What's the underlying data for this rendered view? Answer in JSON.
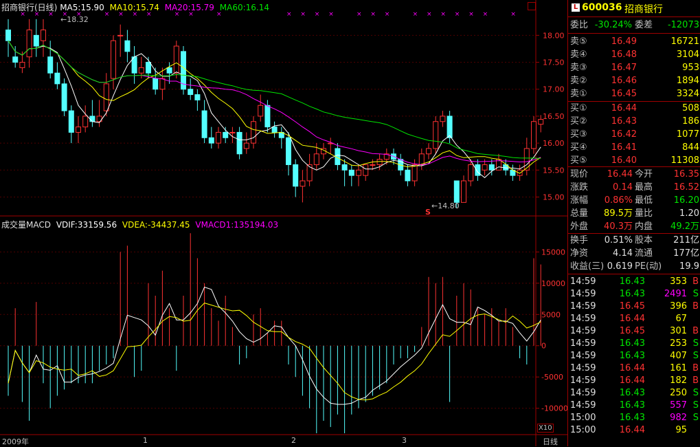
{
  "header": {
    "title": "招商银行(日线)",
    "ma5": "MA5:15.90",
    "ma10": "MA10:15.74",
    "ma20": "MA20:15.79",
    "ma60": "MA60:16.14",
    "colors": {
      "ma5": "#ffffff",
      "ma10": "#ffff00",
      "ma20": "#ff00ff",
      "ma60": "#00e600"
    }
  },
  "price_axis": {
    "ticks": [
      "18.00",
      "17.50",
      "17.00",
      "16.50",
      "16.00",
      "15.50",
      "15.00"
    ]
  },
  "annotations": {
    "high_label": "18.32",
    "low_label": "14.80",
    "signal_s": "S"
  },
  "volume_panel": {
    "title": "成交量MACD",
    "vdif": "VDIF:33159.56",
    "vdea": "VDEA:-34437.45",
    "vmacd": "VMACD1:135194.03",
    "ticks": [
      "15000",
      "10000",
      "5000",
      "0",
      "-5000",
      "-10000"
    ],
    "unit": "X10"
  },
  "date_axis": {
    "labels": [
      "2009年",
      "1",
      "2",
      "3"
    ],
    "period_button": "日线"
  },
  "chart_data": {
    "type": "candlestick",
    "ylim": [
      14.7,
      18.4
    ],
    "candles": [
      [
        18.1,
        17.9,
        18.3,
        17.6
      ],
      [
        17.6,
        17.5,
        17.8,
        17.4
      ],
      [
        17.4,
        17.5,
        17.7,
        17.3
      ],
      [
        17.6,
        18.1,
        18.3,
        17.4
      ],
      [
        18.0,
        17.8,
        18.3,
        17.6
      ],
      [
        17.9,
        18.1,
        18.3,
        17.6
      ],
      [
        17.6,
        17.3,
        17.9,
        17.2
      ],
      [
        17.3,
        17.1,
        17.5,
        17.0
      ],
      [
        17.1,
        16.6,
        17.2,
        16.5
      ],
      [
        16.6,
        16.2,
        16.7,
        16.0
      ],
      [
        16.2,
        16.3,
        16.5,
        16.0
      ],
      [
        16.3,
        16.5,
        16.7,
        16.2
      ],
      [
        16.5,
        16.4,
        16.8,
        16.3
      ],
      [
        16.4,
        16.5,
        16.8,
        16.3
      ],
      [
        16.6,
        17.1,
        17.3,
        16.5
      ],
      [
        17.2,
        17.9,
        18.0,
        17.0
      ],
      [
        18.0,
        18.0,
        18.2,
        17.6
      ],
      [
        17.9,
        17.7,
        18.1,
        17.5
      ],
      [
        17.6,
        17.3,
        17.8,
        17.1
      ],
      [
        17.3,
        17.4,
        17.6,
        17.2
      ],
      [
        17.5,
        17.3,
        17.6,
        17.2
      ],
      [
        17.2,
        17.0,
        17.4,
        16.9
      ],
      [
        17.0,
        17.2,
        17.4,
        16.8
      ],
      [
        17.4,
        17.3,
        17.5,
        17.1
      ],
      [
        17.3,
        17.8,
        17.9,
        17.2
      ],
      [
        17.7,
        17.0,
        17.8,
        16.9
      ],
      [
        17.0,
        16.9,
        17.2,
        16.8
      ],
      [
        16.9,
        16.8,
        17.0,
        16.6
      ],
      [
        16.6,
        16.1,
        16.8,
        16.0
      ],
      [
        16.1,
        16.0,
        16.3,
        15.9
      ],
      [
        16.0,
        16.2,
        16.3,
        15.9
      ],
      [
        16.2,
        16.1,
        16.3,
        16.0
      ],
      [
        16.2,
        16.2,
        16.3,
        16.0
      ],
      [
        16.2,
        15.8,
        16.3,
        15.7
      ],
      [
        15.9,
        16.0,
        16.2,
        15.8
      ],
      [
        16.0,
        16.4,
        16.5,
        15.9
      ],
      [
        16.5,
        16.7,
        16.9,
        16.4
      ],
      [
        16.7,
        16.3,
        16.8,
        16.2
      ],
      [
        16.3,
        16.2,
        16.4,
        16.1
      ],
      [
        16.2,
        16.1,
        16.3,
        15.9
      ],
      [
        16.1,
        15.6,
        16.2,
        15.4
      ],
      [
        15.6,
        15.2,
        15.7,
        15.0
      ],
      [
        15.2,
        15.3,
        15.5,
        14.9
      ],
      [
        15.3,
        15.6,
        15.8,
        15.2
      ],
      [
        15.6,
        15.8,
        16.0,
        15.5
      ],
      [
        15.8,
        15.9,
        16.0,
        15.7
      ],
      [
        16.0,
        16.0,
        16.1,
        15.8
      ],
      [
        15.9,
        15.6,
        16.0,
        15.5
      ],
      [
        15.6,
        15.5,
        15.7,
        15.2
      ],
      [
        15.5,
        15.4,
        15.6,
        15.2
      ],
      [
        15.4,
        15.5,
        15.6,
        15.2
      ],
      [
        15.4,
        15.6,
        15.6,
        15.3
      ],
      [
        15.6,
        15.6,
        15.7,
        15.5
      ],
      [
        15.6,
        15.7,
        15.8,
        15.5
      ],
      [
        15.7,
        15.8,
        15.9,
        15.6
      ],
      [
        15.8,
        15.7,
        15.9,
        15.6
      ],
      [
        15.7,
        15.5,
        15.8,
        15.4
      ],
      [
        15.5,
        15.3,
        15.6,
        15.2
      ],
      [
        15.3,
        15.6,
        15.7,
        15.2
      ],
      [
        15.6,
        15.8,
        15.9,
        15.5
      ],
      [
        15.8,
        15.9,
        16.0,
        15.7
      ],
      [
        15.9,
        16.4,
        16.5,
        15.8
      ],
      [
        16.4,
        16.5,
        16.6,
        16.3
      ],
      [
        16.5,
        16.1,
        16.6,
        16.0
      ],
      [
        15.3,
        14.9,
        15.3,
        14.8
      ],
      [
        14.9,
        15.3,
        15.4,
        14.9
      ],
      [
        15.3,
        15.6,
        15.7,
        15.2
      ],
      [
        15.6,
        15.4,
        15.7,
        15.3
      ],
      [
        15.5,
        15.6,
        15.7,
        15.4
      ],
      [
        15.6,
        15.5,
        15.7,
        15.4
      ],
      [
        15.5,
        15.7,
        15.8,
        15.5
      ],
      [
        15.6,
        15.5,
        15.7,
        15.4
      ],
      [
        15.5,
        15.4,
        15.6,
        15.3
      ],
      [
        15.4,
        15.5,
        15.6,
        15.3
      ],
      [
        15.5,
        15.9,
        16.1,
        15.4
      ],
      [
        15.9,
        16.4,
        16.5,
        15.8
      ],
      [
        16.35,
        16.44,
        16.52,
        16.2
      ]
    ],
    "volume_bars": [
      -8,
      6,
      -9,
      -12,
      7,
      -6,
      -10,
      -8,
      -7,
      -6,
      -6,
      -6,
      -6,
      -4,
      -3,
      -2,
      15,
      16,
      -5,
      -4,
      10,
      8,
      12,
      6,
      -4,
      8,
      18,
      14,
      10,
      6,
      4,
      8,
      3,
      -3,
      -2,
      5,
      6,
      2,
      4,
      4,
      -3,
      -5,
      -8,
      -10,
      -14,
      -12,
      -13,
      -11,
      -14,
      -11,
      -10,
      -9,
      -8,
      -7,
      -6,
      -3,
      -2,
      -2,
      -1,
      3,
      11,
      10,
      11,
      -9,
      8,
      10,
      9,
      6,
      5,
      6,
      4,
      6,
      3,
      -2,
      -3,
      14,
      13
    ],
    "ma_lines": [
      "ma5",
      "ma10",
      "ma20",
      "ma60"
    ]
  },
  "quote": {
    "code": "600036",
    "name": "招商银行",
    "badge": "L",
    "weibi_label": "委比",
    "weibi_value": "-30.24%",
    "weicha_label": "委差",
    "weicha_value": "-12073",
    "sell": [
      {
        "label": "卖⑤",
        "price": "16.49",
        "vol": "16721"
      },
      {
        "label": "卖④",
        "price": "16.48",
        "vol": "3104"
      },
      {
        "label": "卖③",
        "price": "16.47",
        "vol": "953"
      },
      {
        "label": "卖②",
        "price": "16.46",
        "vol": "1894"
      },
      {
        "label": "卖①",
        "price": "16.45",
        "vol": "3324"
      }
    ],
    "buy": [
      {
        "label": "买①",
        "price": "16.44",
        "vol": "508"
      },
      {
        "label": "买②",
        "price": "16.43",
        "vol": "186"
      },
      {
        "label": "买③",
        "price": "16.42",
        "vol": "1077"
      },
      {
        "label": "买④",
        "price": "16.41",
        "vol": "844"
      },
      {
        "label": "买⑤",
        "price": "16.40",
        "vol": "11308"
      }
    ],
    "stats": [
      {
        "l1": "现价",
        "v1": "16.44",
        "c1": "red",
        "l2": "今开",
        "v2": "16.35",
        "c2": "red"
      },
      {
        "l1": "涨跌",
        "v1": "0.14",
        "c1": "red",
        "l2": "最高",
        "v2": "16.52",
        "c2": "red"
      },
      {
        "l1": "涨幅",
        "v1": "0.86%",
        "c1": "red",
        "l2": "最低",
        "v2": "16.20",
        "c2": "green"
      },
      {
        "l1": "总量",
        "v1": "89.5万",
        "c1": "yellow",
        "l2": "量比",
        "v2": "1.20",
        "c2": "white"
      },
      {
        "l1": "外盘",
        "v1": "40.3万",
        "c1": "red",
        "l2": "内盘",
        "v2": "49.2万",
        "c2": "green"
      }
    ],
    "fin": [
      {
        "l1": "换手",
        "v1": "0.51%",
        "l2": "股本",
        "v2": "211亿"
      },
      {
        "l1": "净资",
        "v1": "4.14",
        "l2": "流通",
        "v2": "177亿"
      },
      {
        "l1": "收益(三)",
        "v1": "0.619",
        "l2": "PE(动)",
        "v2": "19.9"
      }
    ],
    "ticks": [
      {
        "time": "14:59",
        "price": "16.43",
        "pc": "green",
        "vol": "353",
        "vc": "yellow",
        "side": "B"
      },
      {
        "time": "14:59",
        "price": "16.43",
        "pc": "green",
        "vol": "2491",
        "vc": "magenta",
        "side": "S"
      },
      {
        "time": "14:59",
        "price": "16.45",
        "pc": "red",
        "vol": "396",
        "vc": "yellow",
        "side": "B"
      },
      {
        "time": "14:59",
        "price": "16.44",
        "pc": "red",
        "vol": "67",
        "vc": "yellow",
        "side": ""
      },
      {
        "time": "14:59",
        "price": "16.45",
        "pc": "red",
        "vol": "301",
        "vc": "yellow",
        "side": "B"
      },
      {
        "time": "14:59",
        "price": "16.43",
        "pc": "green",
        "vol": "253",
        "vc": "yellow",
        "side": "S"
      },
      {
        "time": "14:59",
        "price": "16.43",
        "pc": "green",
        "vol": "407",
        "vc": "yellow",
        "side": "S"
      },
      {
        "time": "14:59",
        "price": "16.44",
        "pc": "red",
        "vol": "161",
        "vc": "yellow",
        "side": "B"
      },
      {
        "time": "14:59",
        "price": "16.44",
        "pc": "red",
        "vol": "182",
        "vc": "yellow",
        "side": "B"
      },
      {
        "time": "14:59",
        "price": "16.43",
        "pc": "green",
        "vol": "250",
        "vc": "yellow",
        "side": "S"
      },
      {
        "time": "14:59",
        "price": "16.43",
        "pc": "green",
        "vol": "557",
        "vc": "magenta",
        "side": "S"
      },
      {
        "time": "15:00",
        "price": "16.43",
        "pc": "green",
        "vol": "982",
        "vc": "magenta",
        "side": "S"
      },
      {
        "time": "15:00",
        "price": "16.44",
        "pc": "red",
        "vol": "95",
        "vc": "yellow",
        "side": ""
      }
    ]
  }
}
